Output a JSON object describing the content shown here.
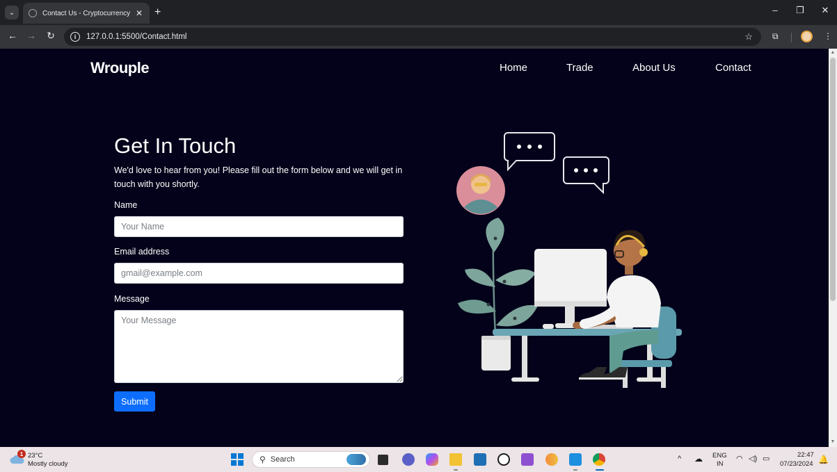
{
  "browser": {
    "tab_title": "Contact Us - Cryptocurrency",
    "url": "127.0.0.1:5500/Contact.html"
  },
  "site": {
    "logo": "Wrouple",
    "nav": [
      "Home",
      "Trade",
      "About Us",
      "Contact"
    ]
  },
  "contact": {
    "heading": "Get In Touch",
    "description": "We'd love to hear from you! Please fill out the form below and we will get in touch with you shortly.",
    "name_label": "Name",
    "name_placeholder": "Your Name",
    "email_label": "Email address",
    "email_placeholder": "gmail@example.com",
    "message_label": "Message",
    "message_placeholder": "Your Message",
    "submit_label": "Submit"
  },
  "taskbar": {
    "weather_badge": "1",
    "temperature": "23°C",
    "weather": "Mostly cloudy",
    "search_label": "Search",
    "lang_top": "ENG",
    "lang_bottom": "IN",
    "time": "22:47",
    "date": "07/23/2024"
  },
  "colors": {
    "page_bg": "#03021a",
    "accent": "#0d6efd"
  }
}
